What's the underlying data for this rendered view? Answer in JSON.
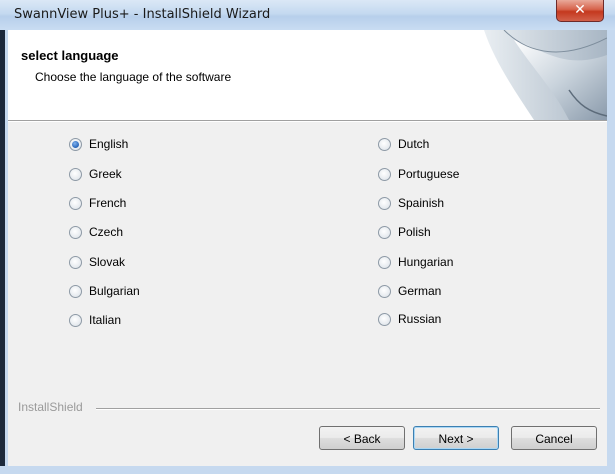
{
  "window": {
    "title": "SwannView Plus+ - InstallShield Wizard",
    "close_icon": "close-icon"
  },
  "header": {
    "title": "select language",
    "subtitle": "Choose the language of the software"
  },
  "languages": {
    "left": [
      "English",
      "Greek",
      "French",
      "Czech",
      "Slovak",
      "Bulgarian",
      "Italian"
    ],
    "right": [
      "Dutch",
      "Portuguese",
      "Spainish",
      "Polish",
      "Hungarian",
      "German",
      "Russian"
    ],
    "selected": "English"
  },
  "footer": {
    "brand": "InstallShield",
    "back_label": "< Back",
    "next_label": "Next >",
    "cancel_label": "Cancel"
  },
  "colors": {
    "titlebar": "#c4d9f0",
    "close_button": "#c4381e",
    "radio_selected": "#2563b8"
  }
}
